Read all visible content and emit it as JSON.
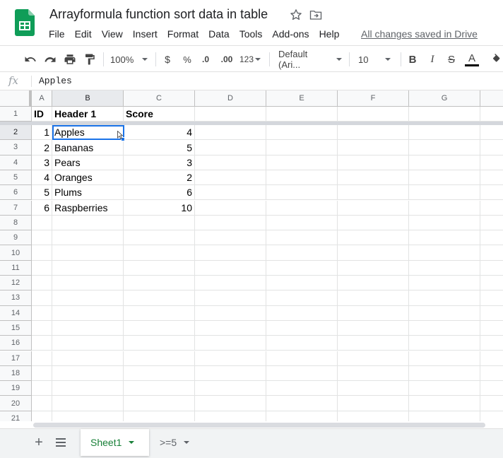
{
  "title_bar": {
    "doc_title": "Arrayformula function sort data in table",
    "save_status": "All changes saved in Drive"
  },
  "menu": [
    "File",
    "Edit",
    "View",
    "Insert",
    "Format",
    "Data",
    "Tools",
    "Add-ons",
    "Help"
  ],
  "toolbar": {
    "zoom": "100%",
    "currency": "$",
    "percent": "%",
    "decrease_decimal": ".0",
    "increase_decimal": ".00",
    "more_formats": "123",
    "font": "Default (Ari...",
    "font_size": "10",
    "bold": "B",
    "italic": "I",
    "strikethrough": "S",
    "text_color": "A"
  },
  "formula_bar": {
    "fx": "fx",
    "value": "Apples"
  },
  "grid": {
    "columns": [
      "A",
      "B",
      "C",
      "D",
      "E",
      "F",
      "G"
    ],
    "row_numbers": [
      "1",
      "2",
      "3",
      "4",
      "5",
      "6",
      "7",
      "8",
      "9",
      "10",
      "11",
      "12",
      "13",
      "14",
      "15",
      "16",
      "17",
      "18",
      "19",
      "20",
      "21"
    ],
    "header": [
      "ID",
      "Header 1",
      "Score"
    ],
    "rows": [
      [
        "1",
        "Apples",
        "4"
      ],
      [
        "2",
        "Bananas",
        "5"
      ],
      [
        "3",
        "Pears",
        "3"
      ],
      [
        "4",
        "Oranges",
        "2"
      ],
      [
        "5",
        "Plums",
        "6"
      ],
      [
        "6",
        "Raspberries",
        "10"
      ]
    ],
    "active_cell": "B2"
  },
  "sheets": {
    "tabs": [
      "Sheet1",
      ">=5"
    ],
    "active": "Sheet1",
    "add_label": "+"
  },
  "colors": {
    "accent": "#1a73e8",
    "sheet_tab_active": "#188038",
    "logo": "#0f9d58"
  }
}
